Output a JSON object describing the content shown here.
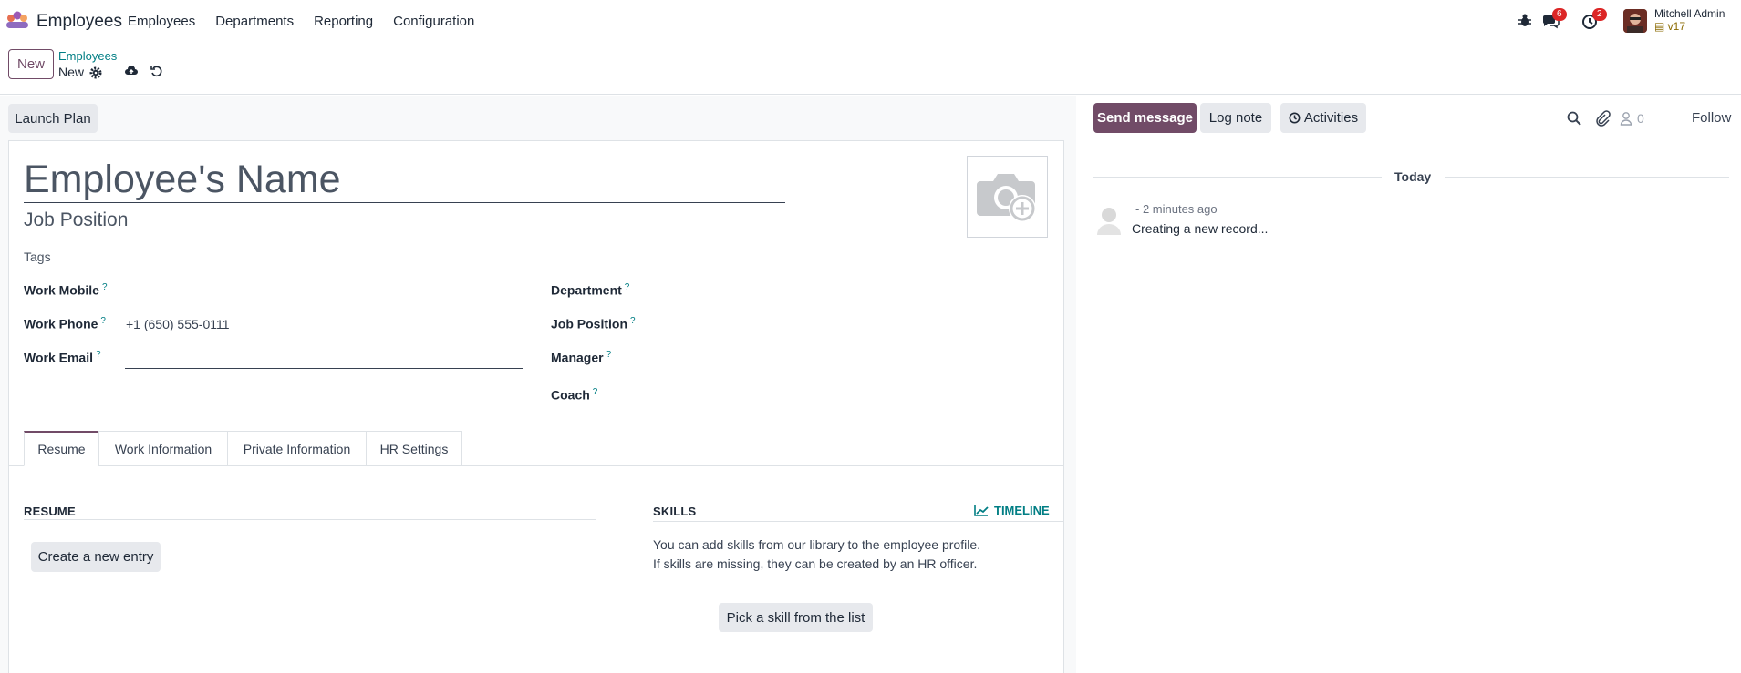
{
  "navbar": {
    "app_name": "Employees",
    "menu": [
      "Employees",
      "Departments",
      "Reporting",
      "Configuration"
    ],
    "messages_badge": "6",
    "activities_badge": "2",
    "user_name": "Mitchell Admin",
    "database": "v17"
  },
  "control_panel": {
    "new_label": "New",
    "breadcrumb_parent": "Employees",
    "breadcrumb_current": "New"
  },
  "form": {
    "launch_plan_label": "Launch Plan",
    "name_placeholder": "Employee's Name",
    "job_position_placeholder": "Job Position",
    "tags_placeholder": "Tags",
    "left_fields": [
      {
        "label": "Work Mobile",
        "value": ""
      },
      {
        "label": "Work Phone",
        "value": "+1 (650) 555-0111"
      },
      {
        "label": "Work Email",
        "value": ""
      }
    ],
    "right_fields": [
      {
        "label": "Department",
        "value": ""
      },
      {
        "label": "Job Position",
        "value": ""
      },
      {
        "label": "Manager",
        "value": ""
      },
      {
        "label": "Coach",
        "value": ""
      }
    ],
    "help_mark": "?",
    "tabs": [
      "Resume",
      "Work Information",
      "Private Information",
      "HR Settings"
    ],
    "active_tab": "Resume",
    "resume": {
      "title": "RESUME",
      "create_entry_label": "Create a new entry"
    },
    "skills": {
      "title": "SKILLS",
      "timeline_label": "TIMELINE",
      "line1": "You can add skills from our library to the employee profile.",
      "line2": "If skills are missing, they can be created by an HR officer.",
      "pick_label": "Pick a skill from the list"
    }
  },
  "chatter": {
    "send_message_label": "Send message",
    "log_note_label": "Log note",
    "activities_label": "Activities",
    "follower_count": "0",
    "follow_label": "Follow",
    "date_separator": "Today",
    "message_time": "- 2 minutes ago",
    "message_body": "Creating a new record..."
  },
  "colors": {
    "primary": "#714b67",
    "link": "#017e84",
    "badge": "#dc2626"
  }
}
